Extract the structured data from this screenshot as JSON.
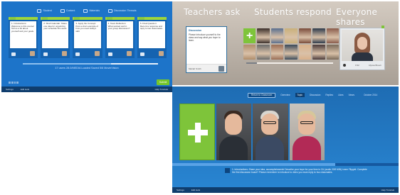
{
  "left_panel": {
    "nav": [
      "Student",
      "Content",
      "Materials",
      "Discussion Threads"
    ],
    "cards": [
      {
        "label": "1. Introductions: Welcome to this course! Tell us a bit about yourself and your goals."
      },
      {
        "label": "2. Shell Calendar: Share one idea for organizing your schedule this week."
      },
      {
        "label": "3. Apply the Concept: Post a short example of how you used today's skill."
      },
      {
        "label": "4. Team Reflection: What worked well in your group discussion?"
      },
      {
        "label": "5. Final Question: Record a response and reply to two classmates."
      }
    ],
    "progress_fraction": 0.65,
    "caption": "17 users 28.0/MEDIA Loaded Saved 5/6 MovieVision",
    "bottom_left": "Settings",
    "bottom_left2": "Edit tools",
    "bottom_right": "Help Tutorials",
    "action_button": "Submit"
  },
  "top_right_panel": {
    "heading_teachers": "Teachers ask",
    "heading_students": "Students respond",
    "heading_everyone": "Everyone shares",
    "question_title": "Discussion",
    "question_text": "Please introduce yourself to the class and say what you hope to learn.",
    "teacher_name": "Mariah Smith",
    "slider_fraction": 0.12,
    "video_caption": "0:32",
    "video_name": "Alyssa Brown",
    "face_colors": [
      "#3b2f2a",
      "#5a6f8f",
      "#c9b07a",
      "#7a4b3a",
      "#2d3a4b",
      "#8a5b4b",
      "#b08c6a",
      "#6a6a6a",
      "#9a6d55",
      "#3a4a5a",
      "#d9b08a",
      "#4a3a3a",
      "#7a6a5a"
    ]
  },
  "bottom_right_panel": {
    "pill": "Return to Classroom",
    "tabs": [
      "Overview",
      "Topic",
      "Discussion",
      "Replies",
      "Likes",
      "Views"
    ],
    "active_tab": 1,
    "date": "October 2014",
    "progress_fraction": 0.72,
    "note": "1. Introductions: Share your idea, accomplishments! Describe your hope for your time in CU (audio 20/5 MIN) Learn Flipgrid. Complete the first discussion board? Please remember to introduce to video you must reply to two classmates.",
    "bottom_left": "Settings",
    "bottom_left2": "Edit tools",
    "bottom_right": "Help Tutorials"
  }
}
